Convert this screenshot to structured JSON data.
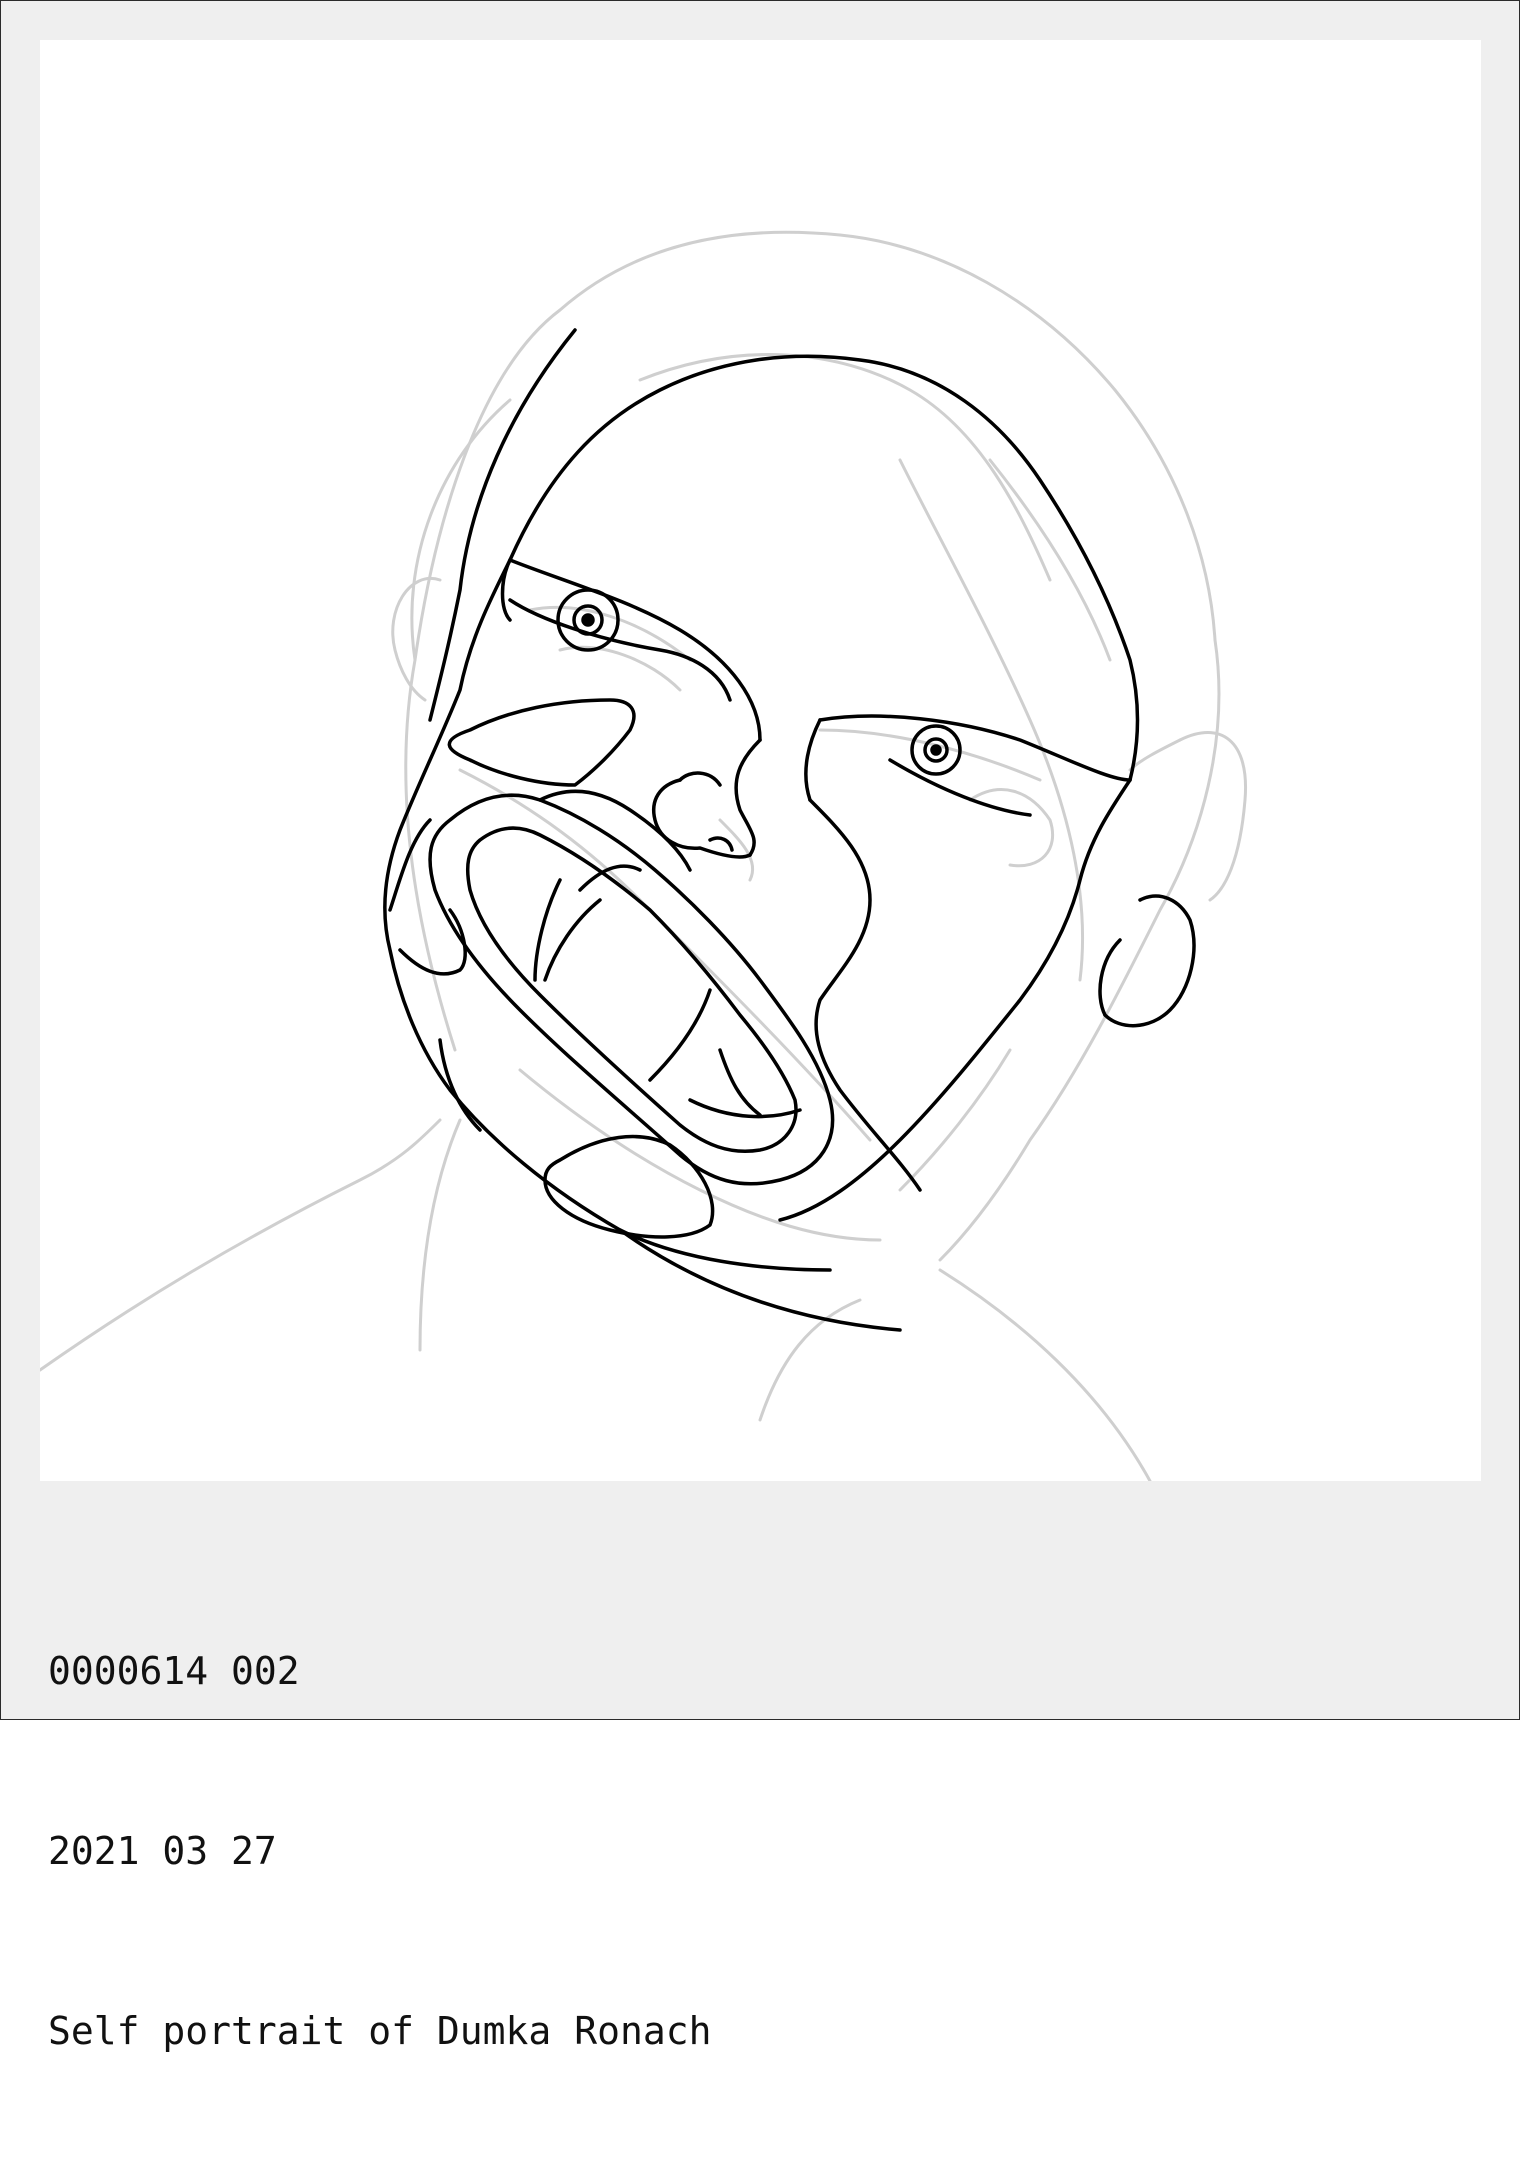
{
  "colors": {
    "frame_background": "#efefef",
    "photo_background": "#ffffff",
    "primary_line": "#000000",
    "secondary_line": "#cfcfcf",
    "caption_text": "#111111"
  },
  "artwork": {
    "subject": "line-drawing-portrait"
  },
  "caption": {
    "id_line": "0000614 002",
    "date_line": "2021 03 27",
    "title_line": "Self portrait of Dumka Ronach"
  }
}
